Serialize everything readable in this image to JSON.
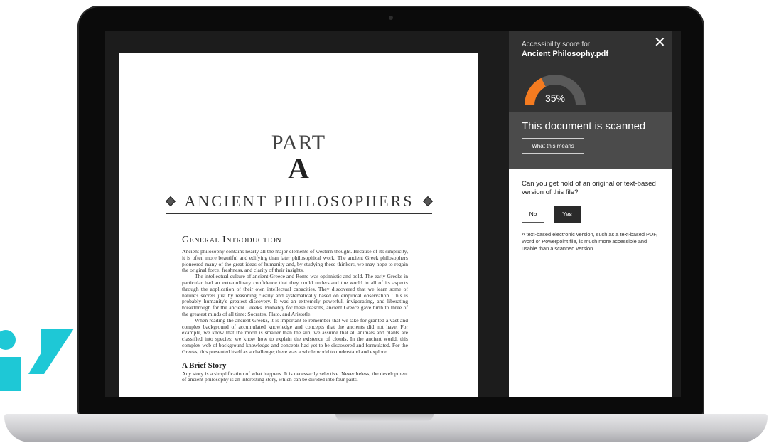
{
  "document": {
    "part_label": "PART",
    "part_letter": "A",
    "chapter_title": "ANCIENT PHILOSOPHERS",
    "section_title": "General Introduction",
    "paragraphs": [
      "Ancient philosophy contains nearly all the major elements of western thought. Because of its simplicity, it is often more beautiful and edifying than later philosophical work. The ancient Greek philosophers pioneered many of the great ideas of humanity and, by studying these thinkers, we may hope to regain the original force, freshness, and clarity of their insights.",
      "The intellectual culture of ancient Greece and Rome was optimistic and bold. The early Greeks in particular had an extraordinary confidence that they could understand the world in all of its aspects through the application of their own intellectual capacities. They discovered that we learn some of nature's secrets just by reasoning clearly and systematically based on empirical observation. This is probably humanity's greatest discovery. It was an extremely powerful, invigorating, and liberating breakthrough for the ancient Greeks. Probably for these reasons, ancient Greece gave birth to three of the greatest minds of all time: Socrates, Plato, and Aristotle.",
      "When reading the ancient Greeks, it is important to remember that we take for granted a vast and complex background of accumulated knowledge and concepts that the ancients did not have. For example, we know that the moon is smaller than the sun; we assume that all animals and plants are classified into species; we know how to explain the existence of clouds. In the ancient world, this complex web of background knowledge and concepts had yet to be discovered and formulated. For the Greeks, this presented itself as a challenge; there was a whole world to understand and explore."
    ],
    "subsection_title": "A Brief Story",
    "subsection_paragraph": "Any story is a simplification of what happens. It is necessarily selective. Nevertheless, the development of ancient philosophy is an interesting story, which can be divided into four parts."
  },
  "panel": {
    "score_for_label": "Accessibility score for:",
    "file_name": "Ancient Philosophy.pdf",
    "close_icon": "close-icon",
    "score_percent": 35,
    "score_label": "35%",
    "gauge_color": "#f47b20",
    "gauge_track_color": "#5a5a5a",
    "status_text": "This document is scanned",
    "what_button": "What this means",
    "question": "Can you get hold of an original or text-based version of this file?",
    "no_button": "No",
    "yes_button": "Yes",
    "note": "A text-based electronic version, such as a text-based PDF, Word or Powerpoint file, is much more accessible and usable than a scanned version."
  },
  "brand": {
    "color": "#1ec8d6",
    "icon": "brand-mark-icon"
  }
}
